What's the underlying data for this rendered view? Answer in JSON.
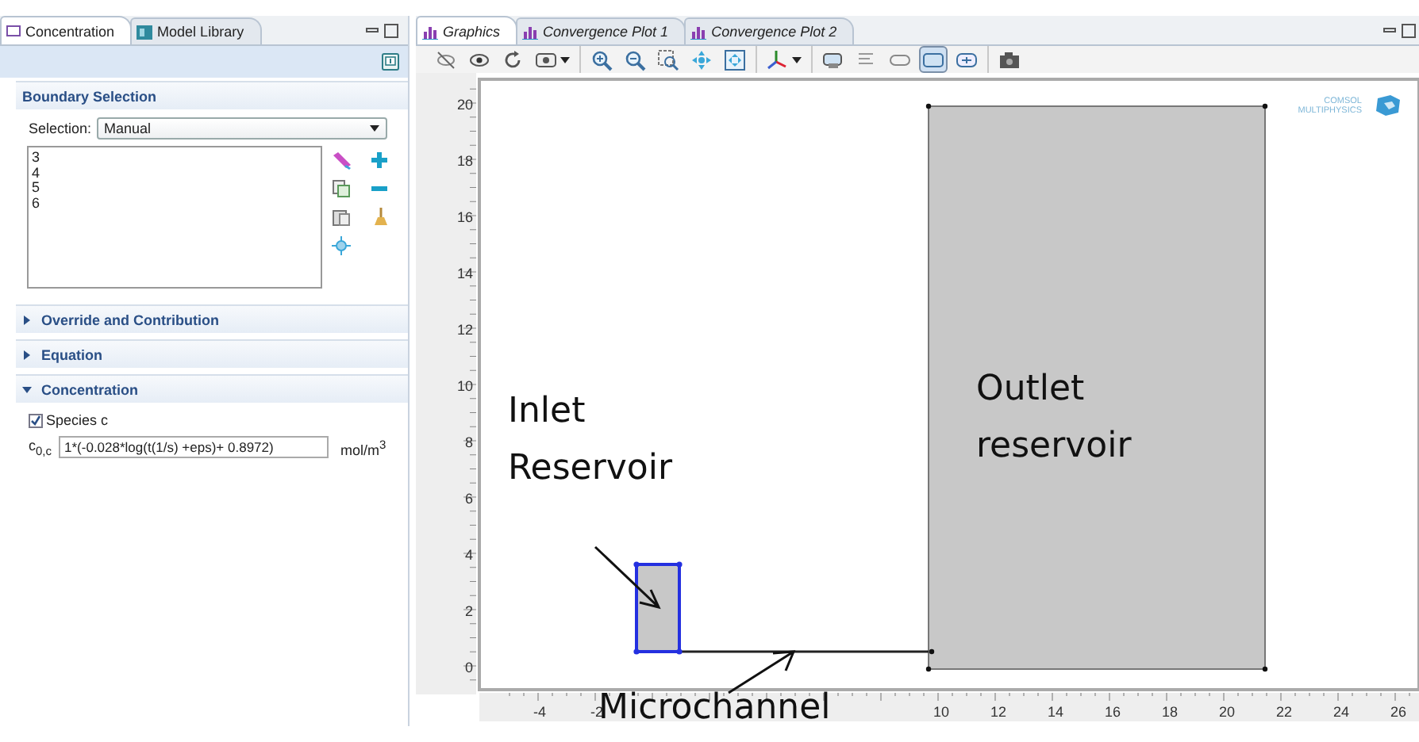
{
  "left_panel": {
    "tabs": [
      {
        "label": "Concentration",
        "selected": true
      },
      {
        "label": "Model Library",
        "selected": false
      }
    ],
    "boundary_selection": {
      "title": "Boundary Selection",
      "selection_label": "Selection:",
      "selection_value": "Manual",
      "boundaries": [
        "3",
        "4",
        "5",
        "6"
      ]
    },
    "sections": [
      {
        "title": "Override and Contribution",
        "expanded": false
      },
      {
        "title": "Equation",
        "expanded": false
      },
      {
        "title": "Concentration",
        "expanded": true
      }
    ],
    "species": {
      "label": "Species c",
      "checked": true
    },
    "concentration": {
      "symbol": "c$_{0,c}$",
      "value": "1*(-0.028*log(t(1/s) +eps)+ 0.8972)",
      "unit": "mol/m$^{3}$"
    }
  },
  "graphics_panel": {
    "tabs": [
      {
        "label": "Graphics",
        "selected": true
      },
      {
        "label": "Convergence Plot 1",
        "selected": false
      },
      {
        "label": "Convergence Plot 2",
        "selected": false
      }
    ],
    "toolbar_groups": [
      [
        {
          "kind": "hide",
          "pressed": false
        },
        {
          "kind": "show",
          "pressed": false
        },
        {
          "kind": "refresh",
          "pressed": false
        },
        {
          "kind": "view-menu",
          "pressed": false
        }
      ],
      [
        {
          "kind": "zoom-in",
          "pressed": false
        },
        {
          "kind": "zoom-out",
          "pressed": false
        },
        {
          "kind": "zoom-box",
          "pressed": false
        },
        {
          "kind": "pan",
          "pressed": false
        },
        {
          "kind": "zoom-extents",
          "pressed": false
        }
      ],
      [
        {
          "kind": "axes-menu",
          "pressed": false
        }
      ],
      [
        {
          "kind": "select-domain",
          "pressed": false
        },
        {
          "kind": "select-boundary",
          "pressed": false
        },
        {
          "kind": "select-edge",
          "pressed": false
        },
        {
          "kind": "select-point",
          "pressed": true
        },
        {
          "kind": "select-all",
          "pressed": false
        }
      ],
      [
        {
          "kind": "camera",
          "pressed": false
        }
      ]
    ],
    "y_ticks": [
      "20",
      "18",
      "16",
      "14",
      "12",
      "10",
      "8",
      "6",
      "4",
      "2",
      "0"
    ],
    "x_ticks": [
      "-4",
      "-2",
      "10",
      "12",
      "14",
      "16",
      "18",
      "20",
      "22",
      "24",
      "26"
    ],
    "logo": {
      "lines": [
        "COMSOL",
        "MULTIPHYSICS"
      ]
    },
    "annotations": [
      {
        "lines": [
          "Inlet",
          "Reservoir"
        ]
      },
      {
        "lines": [
          "Outlet",
          "reservoir"
        ]
      },
      {
        "lines": [
          "Microchannel"
        ]
      }
    ]
  }
}
